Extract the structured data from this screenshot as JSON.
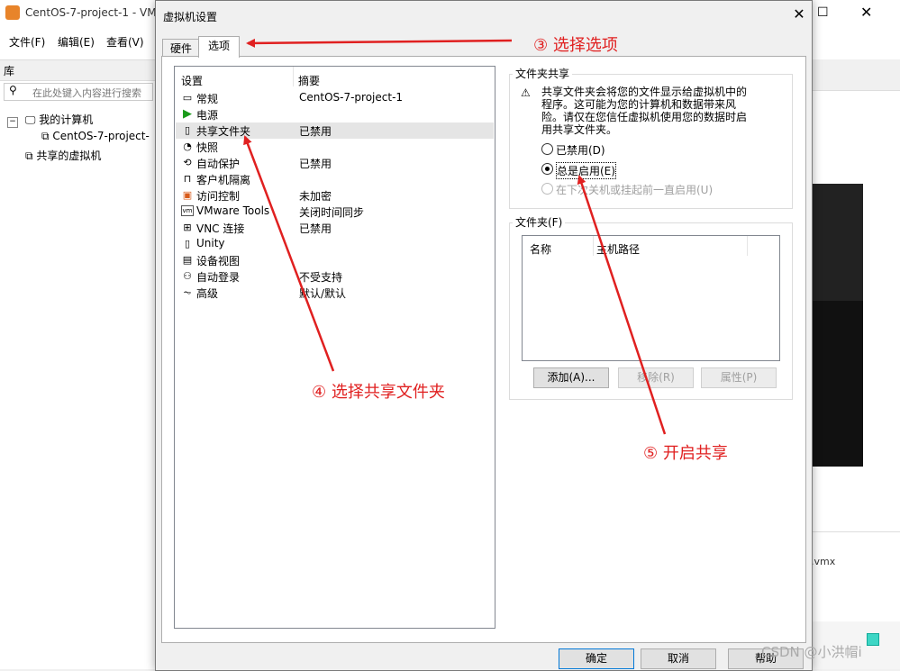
{
  "background_window": {
    "title": "CentOS-7-project-1 - VM",
    "menu": [
      "文件(F)",
      "编辑(E)",
      "查看(V)"
    ],
    "library_label": "库",
    "search_placeholder": "在此处键入内容进行搜索",
    "tree": {
      "root": "我的计算机",
      "vm": "CentOS-7-project-",
      "shared": "共享的虚拟机"
    },
    "vmx_text": ".vmx"
  },
  "dialog": {
    "title": "虚拟机设置",
    "tabs": [
      "硬件",
      "选项"
    ],
    "active_tab": "选项",
    "list_headers": {
      "setting": "设置",
      "summary": "摘要"
    },
    "settings": [
      {
        "label": "常规",
        "summary": "CentOS-7-project-1",
        "icon": "general-icon"
      },
      {
        "label": "电源",
        "summary": "",
        "icon": "power-icon"
      },
      {
        "label": "共享文件夹",
        "summary": "已禁用",
        "icon": "shared-folder-icon",
        "selected": true
      },
      {
        "label": "快照",
        "summary": "",
        "icon": "snapshot-icon"
      },
      {
        "label": "自动保护",
        "summary": "已禁用",
        "icon": "autoprotect-icon"
      },
      {
        "label": "客户机隔离",
        "summary": "",
        "icon": "lock-icon"
      },
      {
        "label": "访问控制",
        "summary": "未加密",
        "icon": "access-control-icon"
      },
      {
        "label": "VMware Tools",
        "summary": "关闭时间同步",
        "icon": "vmware-tools-icon"
      },
      {
        "label": "VNC 连接",
        "summary": "已禁用",
        "icon": "vnc-icon"
      },
      {
        "label": "Unity",
        "summary": "",
        "icon": "unity-icon"
      },
      {
        "label": "设备视图",
        "summary": "",
        "icon": "device-view-icon"
      },
      {
        "label": "自动登录",
        "summary": "不受支持",
        "icon": "autologin-icon"
      },
      {
        "label": "高级",
        "summary": "默认/默认",
        "icon": "advanced-icon"
      }
    ],
    "sharing_group": {
      "title": "文件夹共享",
      "warning": "共享文件夹会将您的文件显示给虚拟机中的程序。这可能为您的计算机和数据带来风险。请仅在您信任虚拟机使用您的数据时启用共享文件夹。",
      "options": [
        {
          "label": "已禁用(D)",
          "checked": false,
          "disabled": false
        },
        {
          "label": "总是启用(E)",
          "checked": true,
          "disabled": false
        },
        {
          "label": "在下次关机或挂起前一直启用(U)",
          "checked": false,
          "disabled": true
        }
      ]
    },
    "folders_group": {
      "title": "文件夹(F)",
      "col_name": "名称",
      "col_host_path": "主机路径",
      "add": "添加(A)...",
      "remove": "移除(R)",
      "properties": "属性(P)"
    },
    "buttons": {
      "ok": "确定",
      "cancel": "取消",
      "help": "帮助"
    }
  },
  "annotations": {
    "step3": "③ 选择选项",
    "step4": "④ 选择共享文件夹",
    "step5": "⑤ 开启共享",
    "color": "#e02020"
  },
  "watermark": "CSDN @小洪帽i"
}
